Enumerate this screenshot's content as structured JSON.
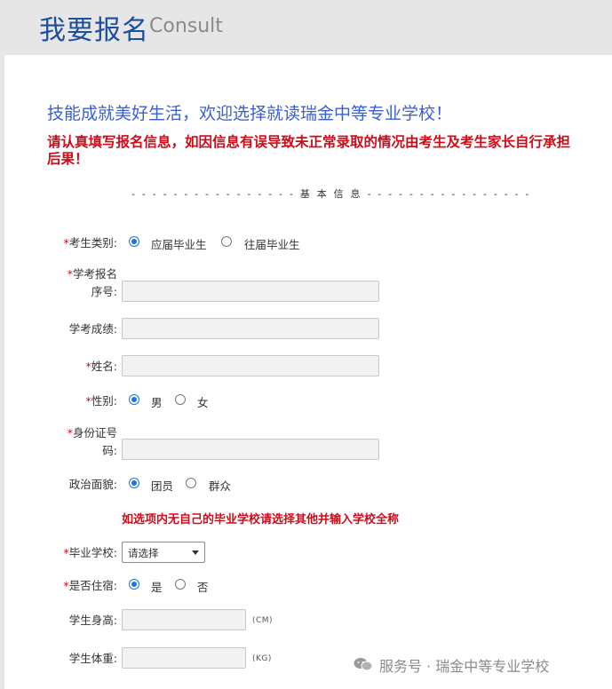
{
  "header": {
    "title": "我要报名",
    "subtitle": "Consult"
  },
  "slogan": "技能成就美好生活，欢迎选择就读瑞金中等专业学校！",
  "warning": "请认真填写报名信息，如因信息有误导致未正常录取的情况由考生及考生家长自行承担后果！",
  "section_divider": "- - - - - - - - - - - - - - - - 基 本 信 息 - - - - - - - - - - - - - - - -",
  "form": {
    "candidate_type": {
      "label": "考生类别:",
      "options": [
        "应届毕业生",
        "往届毕业生"
      ],
      "selected": "应届毕业生"
    },
    "exam_number": {
      "label_line1": "学考报名",
      "label_line2": "序号:",
      "value": ""
    },
    "exam_score": {
      "label": "学考成绩:",
      "value": ""
    },
    "name": {
      "label": "姓名:",
      "value": ""
    },
    "gender": {
      "label": "性别:",
      "options": [
        "男",
        "女"
      ],
      "selected": "男"
    },
    "id_number": {
      "label_line1": "身份证号",
      "label_line2": "码:",
      "value": ""
    },
    "political_status": {
      "label": "政治面貌:",
      "options": [
        "团员",
        "群众"
      ],
      "selected": "团员"
    },
    "school_note": "如选项内无自己的毕业学校请选择其他并输入学校全称",
    "graduate_school": {
      "label": "毕业学校:",
      "selected": "请选择"
    },
    "boarding": {
      "label": "是否住宿:",
      "options": [
        "是",
        "否"
      ],
      "selected": "是"
    },
    "height": {
      "label": "学生身高:",
      "unit": "(CM)",
      "value": ""
    },
    "weight": {
      "label": "学生体重:",
      "unit": "(KG)",
      "value": ""
    }
  },
  "required_mark": "*",
  "watermark": "服务号 · 瑞金中等专业学校",
  "colors": {
    "accent_blue": "#1d4f9c",
    "slogan_blue": "#3b5fd1",
    "warning_red": "#d10a18"
  },
  "icons": {
    "watermark": "wechat-icon"
  }
}
